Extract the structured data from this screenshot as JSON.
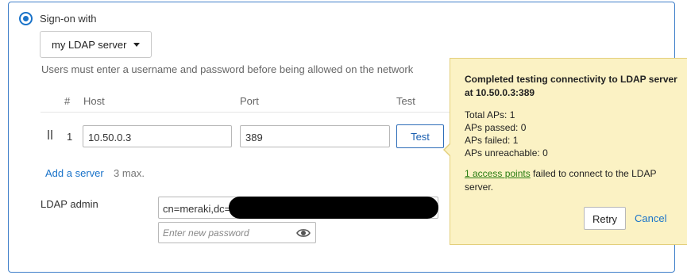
{
  "signon": {
    "label": "Sign-on with",
    "selected": "my LDAP server",
    "hint": "Users must enter a username and password before being allowed on the network"
  },
  "table": {
    "headers": [
      "#",
      "Host",
      "Port",
      "Test"
    ],
    "rows": [
      {
        "num": "1",
        "host": "10.50.0.3",
        "port": "389",
        "test_label": "Test"
      }
    ],
    "add_server": "Add a server",
    "max_note": "3 max."
  },
  "admin": {
    "label": "LDAP admin",
    "dn_value": "cn=meraki,dc=",
    "password_placeholder": "Enter new password"
  },
  "popover": {
    "title": "Completed testing connectivity to LDAP server at 10.50.0.3:389",
    "total": "Total APs: 1",
    "passed": "APs passed: 0",
    "failed": "APs failed: 1",
    "unreachable": "APs unreachable: 0",
    "failed_link": "1 access points",
    "failed_message": " failed to connect to the LDAP server.",
    "retry": "Retry",
    "cancel": "Cancel"
  },
  "icons": {
    "radio": "radio-selected-icon",
    "dropdown_caret": "caret-down-icon",
    "drag": "drag-handle-icon",
    "eye": "eye-icon"
  },
  "colors": {
    "accent": "#1a73c9",
    "popover_bg": "#fbf2c4",
    "link_green": "#2a7d12",
    "border_blue": "#3f7fc9"
  }
}
